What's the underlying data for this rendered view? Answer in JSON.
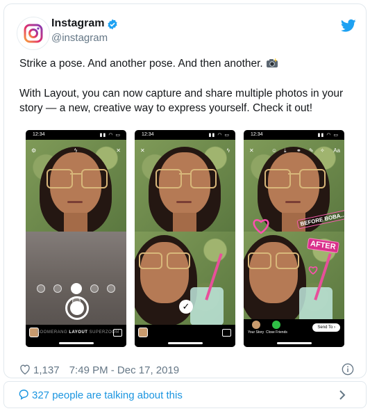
{
  "tweet": {
    "author_name": "Instagram",
    "author_handle": "@instagram",
    "text_line1": "Strike a pose. And another pose. And then another.",
    "text_para2": "With Layout, you can now capture and share multiple photos in your story — a new, creative way to express yourself. Check it out!",
    "likes": "1,137",
    "timestamp": "7:49 PM - Dec 17, 2019",
    "talking": "327 people are talking about this"
  },
  "phones": [
    {
      "status_time": "12:34",
      "modes_left": "BOOMERANG",
      "modes_active": "LAYOUT",
      "modes_right": "SUPERZOOM"
    },
    {
      "status_time": "12:34"
    },
    {
      "status_time": "12:34",
      "sticker_top": "BEFORE BOBA...",
      "sticker_after": "AFTER",
      "send_item_1": "Your Story",
      "send_item_2": "Close Friends",
      "send_button": "Send To"
    }
  ],
  "colors": {
    "verified_blue": "#1da1f2",
    "link_blue": "#1b95e0",
    "twitter_blue": "#1da1f2",
    "muted_grey": "#657786",
    "border": "#e1e8ed"
  },
  "icons": [
    "instagram-logo",
    "verified-badge-icon",
    "twitter-bird-icon",
    "heart-icon",
    "info-icon",
    "speech-bubble-icon",
    "chevron-right-icon"
  ]
}
